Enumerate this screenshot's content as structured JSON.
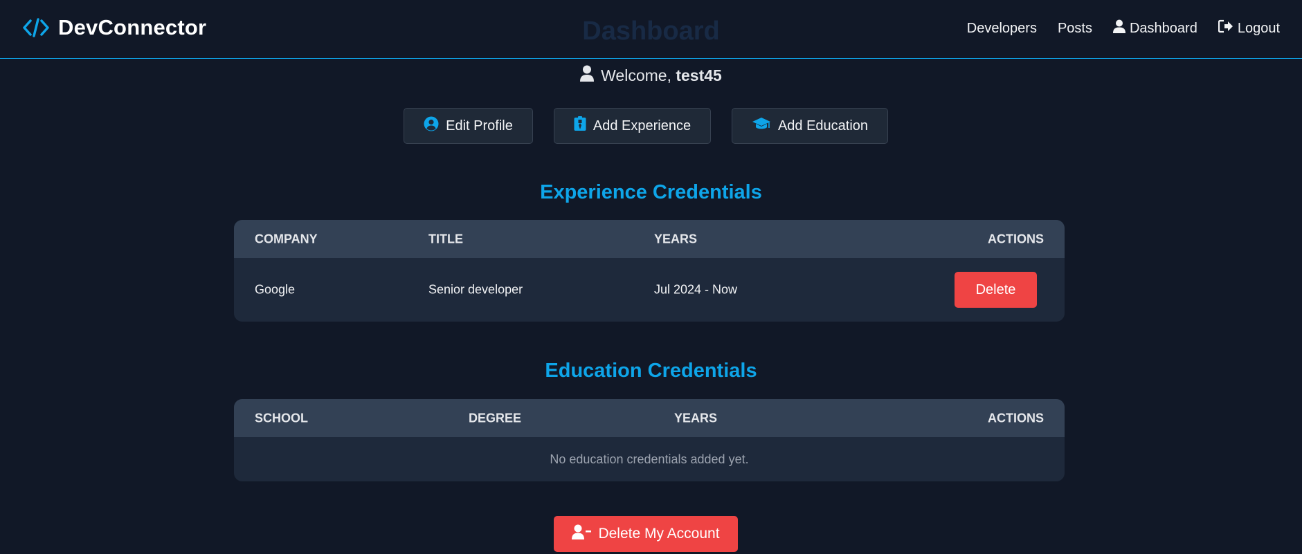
{
  "navbar": {
    "brand": "DevConnector",
    "links": [
      {
        "label": "Developers",
        "icon": ""
      },
      {
        "label": "Posts",
        "icon": ""
      },
      {
        "label": "Dashboard",
        "icon": "user-icon"
      },
      {
        "label": "Logout",
        "icon": "sign-out-icon"
      }
    ]
  },
  "page": {
    "title": "Dashboard",
    "welcome_prefix": "Welcome,",
    "username": "test45"
  },
  "actions": {
    "edit_profile": "Edit Profile",
    "add_experience": "Add Experience",
    "add_education": "Add Education"
  },
  "experience": {
    "heading": "Experience Credentials",
    "columns": [
      "COMPANY",
      "TITLE",
      "YEARS",
      "ACTIONS"
    ],
    "rows": [
      {
        "company": "Google",
        "title": "Senior developer",
        "years": "Jul 2024 - Now",
        "action": "Delete"
      }
    ]
  },
  "education": {
    "heading": "Education Credentials",
    "columns": [
      "SCHOOL",
      "DEGREE",
      "YEARS",
      "ACTIONS"
    ],
    "empty_text": "No education credentials added yet."
  },
  "danger": {
    "delete_account": "Delete My Account"
  },
  "colors": {
    "background": "#111827",
    "accent": "#0ea5e9",
    "danger": "#ef4444",
    "surface": "#1e293b",
    "header": "#334155"
  }
}
